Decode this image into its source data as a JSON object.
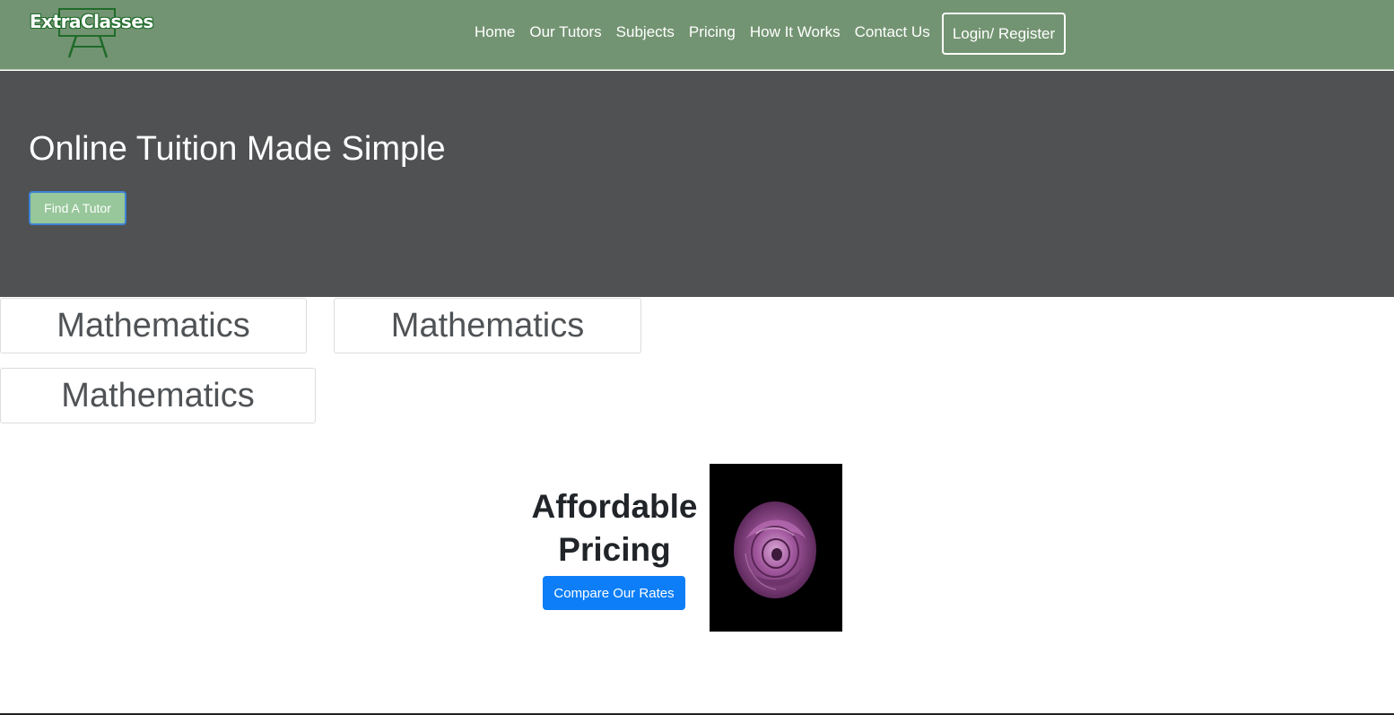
{
  "brand": {
    "logo_text": "ExtraClasses"
  },
  "nav": {
    "items": [
      {
        "label": "Home"
      },
      {
        "label": "Our Tutors"
      },
      {
        "label": "Subjects"
      },
      {
        "label": "Pricing"
      },
      {
        "label": "How It Works"
      },
      {
        "label": "Contact Us"
      }
    ],
    "login_label": "Login/ Register"
  },
  "hero": {
    "title": "Online Tuition Made Simple",
    "button_label": "Find A Tutor"
  },
  "subjects": [
    {
      "label": "Mathematics"
    },
    {
      "label": "Mathematics"
    },
    {
      "label": "Mathematics"
    }
  ],
  "pricing": {
    "title": "Affordable Pricing",
    "button_label": "Compare Our Rates",
    "image": "purple-rose-image"
  },
  "colors": {
    "navbar": "#739472",
    "hero": "#4f5153",
    "find_tutor_button": "#97c79a",
    "primary_button": "#0d7ef7",
    "rose": "#a0569c"
  }
}
